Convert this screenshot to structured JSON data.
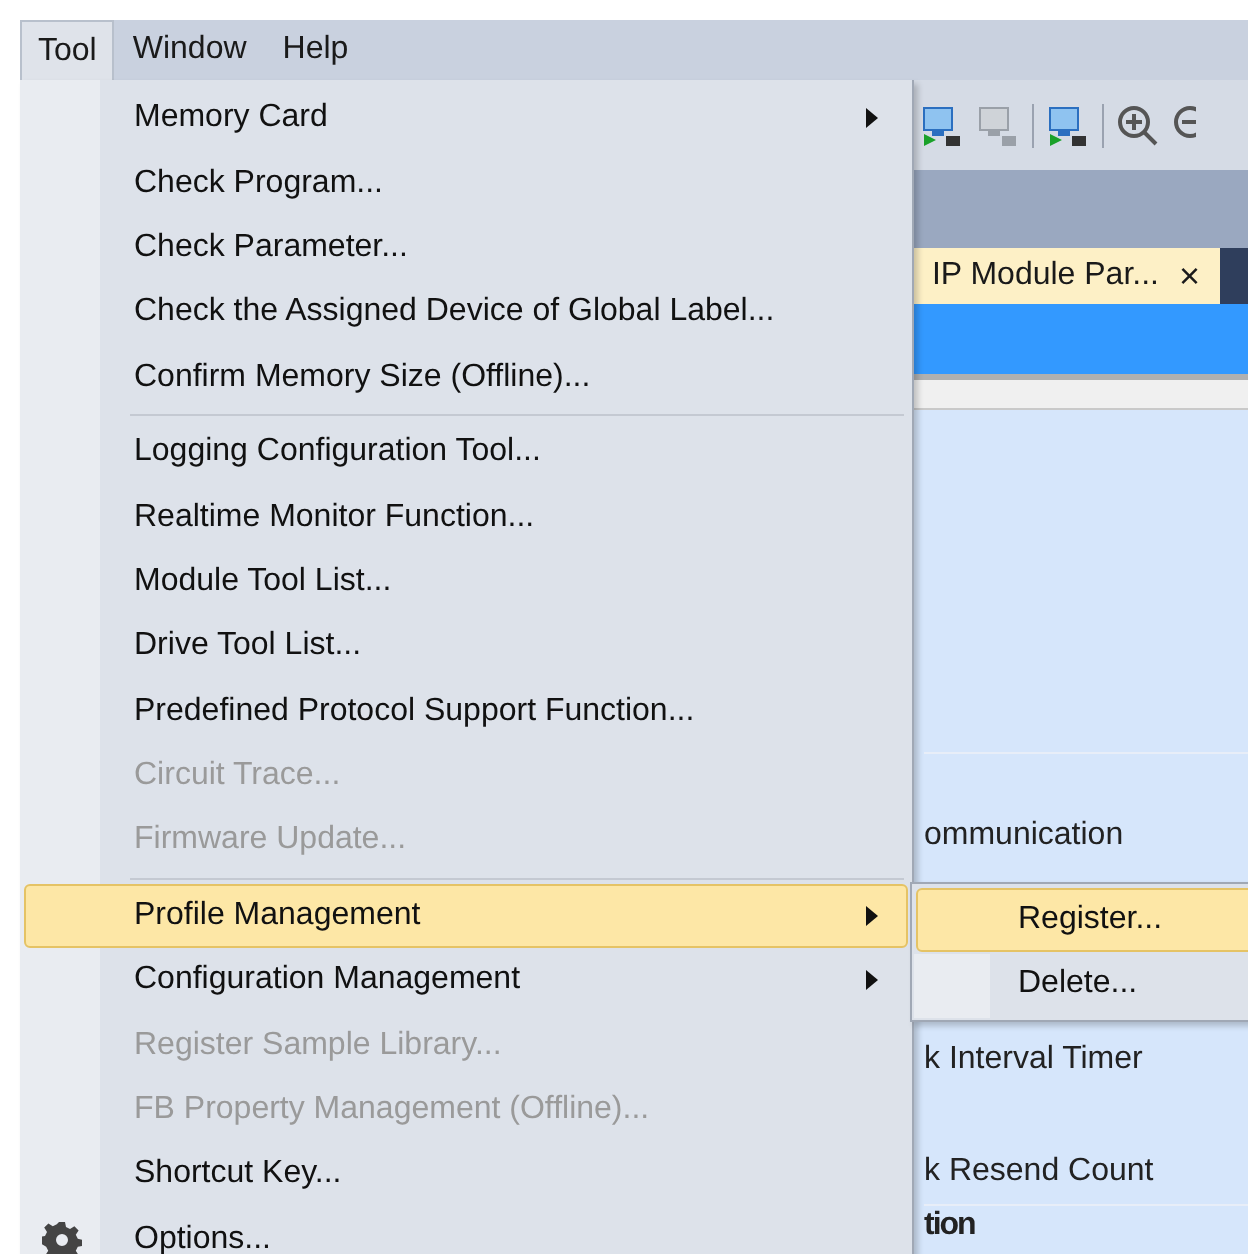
{
  "menubar": [
    {
      "label": "Tool",
      "selected": true
    },
    {
      "label": "Window",
      "selected": false
    },
    {
      "label": "Help",
      "selected": false
    }
  ],
  "tool_menu": {
    "items": [
      {
        "kind": "item",
        "label": "Memory Card",
        "disabled": false,
        "selected": false,
        "submenu": true
      },
      {
        "kind": "item",
        "label": "Check Program...",
        "disabled": false,
        "selected": false,
        "submenu": false
      },
      {
        "kind": "item",
        "label": "Check Parameter...",
        "disabled": false,
        "selected": false,
        "submenu": false
      },
      {
        "kind": "item",
        "label": "Check the Assigned Device of Global Label...",
        "disabled": false,
        "selected": false,
        "submenu": false
      },
      {
        "kind": "item",
        "label": "Confirm Memory Size (Offline)...",
        "disabled": false,
        "selected": false,
        "submenu": false
      },
      {
        "kind": "separator"
      },
      {
        "kind": "item",
        "label": "Logging Configuration Tool...",
        "disabled": false,
        "selected": false,
        "submenu": false
      },
      {
        "kind": "item",
        "label": "Realtime Monitor Function...",
        "disabled": false,
        "selected": false,
        "submenu": false
      },
      {
        "kind": "item",
        "label": "Module Tool List...",
        "disabled": false,
        "selected": false,
        "submenu": false
      },
      {
        "kind": "item",
        "label": "Drive Tool List...",
        "disabled": false,
        "selected": false,
        "submenu": false
      },
      {
        "kind": "item",
        "label": "Predefined Protocol Support Function...",
        "disabled": false,
        "selected": false,
        "submenu": false
      },
      {
        "kind": "item",
        "label": "Circuit Trace...",
        "disabled": true,
        "selected": false,
        "submenu": false
      },
      {
        "kind": "item",
        "label": "Firmware Update...",
        "disabled": true,
        "selected": false,
        "submenu": false
      },
      {
        "kind": "separator"
      },
      {
        "kind": "item",
        "label": "Profile Management",
        "disabled": false,
        "selected": true,
        "submenu": true
      },
      {
        "kind": "item",
        "label": "Configuration Management",
        "disabled": false,
        "selected": false,
        "submenu": true
      },
      {
        "kind": "item",
        "label": "Register Sample Library...",
        "disabled": true,
        "selected": false,
        "submenu": false
      },
      {
        "kind": "item",
        "label": "FB Property Management (Offline)...",
        "disabled": true,
        "selected": false,
        "submenu": false
      },
      {
        "kind": "item",
        "label": "Shortcut Key...",
        "disabled": false,
        "selected": false,
        "submenu": false
      },
      {
        "kind": "icon_item",
        "label": "Options...",
        "disabled": false,
        "selected": false,
        "submenu": false
      }
    ]
  },
  "submenu": {
    "items": [
      {
        "label": "Register...",
        "selected": true
      },
      {
        "label": "Delete...",
        "selected": false
      }
    ]
  },
  "document_tab": {
    "label": "IP Module Par...",
    "close": "×"
  },
  "content_rows": [
    {
      "label": "ommunication",
      "bold": false
    },
    {
      "label": "k Interval Timer",
      "bold": false
    },
    {
      "label": "k Resend Count",
      "bold": false
    },
    {
      "label": "tion",
      "bold": true
    }
  ]
}
